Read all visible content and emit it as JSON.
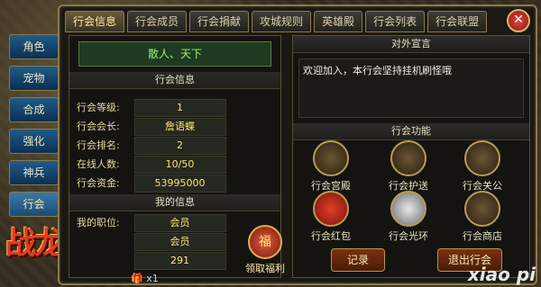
{
  "sidebar": {
    "items": [
      "角色",
      "宠物",
      "合成",
      "强化",
      "神兵",
      "行会"
    ]
  },
  "logo": "战龙城",
  "tabs": [
    "行会信息",
    "行会成员",
    "行会捐献",
    "攻城规则",
    "英雄殿",
    "行会列表",
    "行会联盟"
  ],
  "active_tab": "行会信息",
  "guild_name": "散人、天下",
  "guild_info": {
    "header": "行会信息",
    "rows": [
      {
        "label": "行会等级:",
        "value": "1"
      },
      {
        "label": "行会会长:",
        "value": "詹语蝶"
      },
      {
        "label": "行会排名:",
        "value": "2"
      },
      {
        "label": "在线人数:",
        "value": "10/50"
      },
      {
        "label": "行会资金:",
        "value": "53995000"
      }
    ]
  },
  "my_info": {
    "header": "我的信息",
    "rows": [
      {
        "label": "我的职位:",
        "value": "会员"
      },
      {
        "label": "",
        "value": "会员"
      },
      {
        "label": "",
        "value": "291"
      },
      {
        "label": "",
        "value": "x1"
      }
    ]
  },
  "welfare_button": "领取福利",
  "welfare_icon": "福",
  "announcement": {
    "header": "对外宣言",
    "text": "欢迎加入，本行会坚持挂机刷怪哦"
  },
  "functions": {
    "header": "行会功能",
    "items": [
      "行会宫殿",
      "行会护送",
      "行会关公",
      "行会红包",
      "行会光环",
      "行会商店"
    ]
  },
  "record_button": "记录",
  "exit_button": "退出行会",
  "watermark": "xiao pi"
}
